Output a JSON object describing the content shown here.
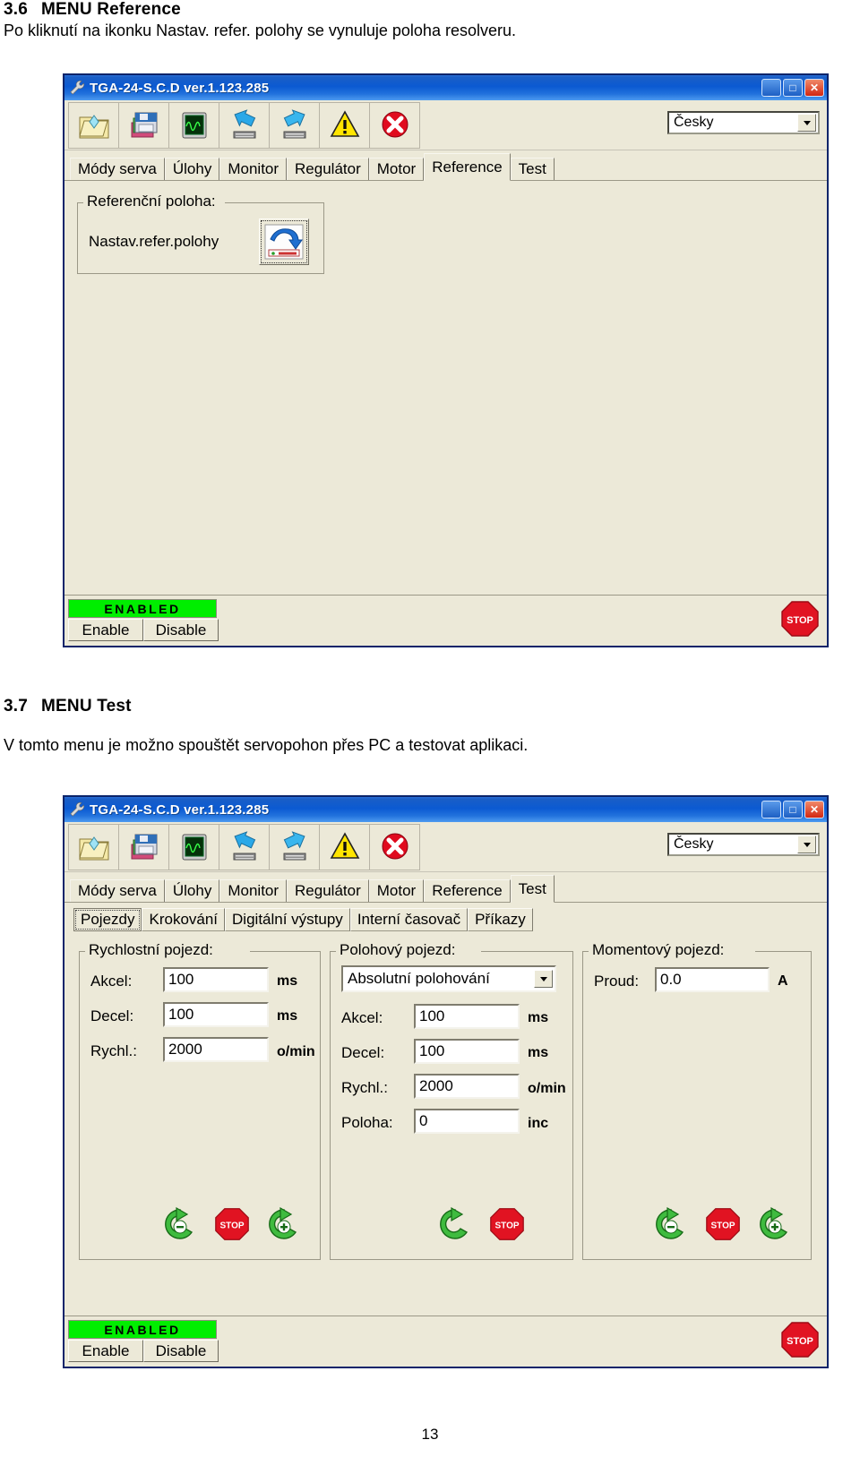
{
  "page": {
    "number": "13"
  },
  "sections": [
    {
      "number": "3.6",
      "heading": "MENU Reference",
      "paragraph": "Po kliknutí na ikonku Nastav. refer. polohy se vynuluje  poloha resolveru."
    },
    {
      "number": "3.7",
      "heading": "MENU Test",
      "paragraph": "V tomto menu je možno spouštět servopohon přes PC a testovat aplikaci."
    }
  ],
  "window": {
    "title": "TGA-24-S.C.D  ver.1.123.285",
    "title_icon": "wrench-icon",
    "buttons": {
      "minimize": "_",
      "maximize": "□",
      "close": "✕"
    },
    "toolbar": {
      "items": [
        {
          "name": "open-folder-icon",
          "title": "Open"
        },
        {
          "name": "save-disk-icon",
          "title": "Save"
        },
        {
          "name": "oscilloscope-icon",
          "title": "Monitor"
        },
        {
          "name": "download-to-drive-icon",
          "title": "Read"
        },
        {
          "name": "upload-to-drive-icon",
          "title": "Write"
        },
        {
          "name": "warning-icon",
          "title": "Warning"
        },
        {
          "name": "error-stop-icon",
          "title": "Error"
        }
      ],
      "language_value": "Česky"
    },
    "tabs": [
      {
        "label": "Módy serva",
        "active_ref": false,
        "active_test": false
      },
      {
        "label": "Úlohy",
        "active_ref": false,
        "active_test": false
      },
      {
        "label": "Monitor",
        "active_ref": false,
        "active_test": false
      },
      {
        "label": "Regulátor",
        "active_ref": false,
        "active_test": false
      },
      {
        "label": "Motor",
        "active_ref": false,
        "active_test": false
      },
      {
        "label": "Reference",
        "active_ref": true,
        "active_test": false
      },
      {
        "label": "Test",
        "active_ref": false,
        "active_test": true
      }
    ],
    "status": {
      "state_text": "ENABLED",
      "enable_label": "Enable",
      "disable_label": "Disable",
      "stop_label": "STOP"
    }
  },
  "reference_panel": {
    "group_title": "Referenční poloha:",
    "action_label": "Nastav.refer.polohy",
    "action_icon": "set-reference-position-icon"
  },
  "test_panel": {
    "subtabs": [
      {
        "label": "Pojezdy",
        "active": true
      },
      {
        "label": "Krokování",
        "active": false
      },
      {
        "label": "Digitální výstupy",
        "active": false
      },
      {
        "label": "Interní časovač",
        "active": false
      },
      {
        "label": "Příkazy",
        "active": false
      }
    ],
    "speed_group": {
      "title": "Rychlostní pojezd:",
      "rows": [
        {
          "label": "Akcel:",
          "value": "100",
          "unit": "ms"
        },
        {
          "label": "Decel:",
          "value": "100",
          "unit": "ms"
        },
        {
          "label": "Rychl.:",
          "value": "2000",
          "unit": "o/min"
        }
      ],
      "controls": [
        {
          "name": "jog-negative-button",
          "icon": "green-arrow-minus-icon"
        },
        {
          "name": "stop-button",
          "icon": "stop-sign-icon",
          "label": "STOP"
        },
        {
          "name": "jog-positive-button",
          "icon": "green-arrow-plus-icon"
        }
      ]
    },
    "position_group": {
      "title": "Polohový pojezd:",
      "mode_value": "Absolutní polohování",
      "rows": [
        {
          "label": "Akcel:",
          "value": "100",
          "unit": "ms"
        },
        {
          "label": "Decel:",
          "value": "100",
          "unit": "ms"
        },
        {
          "label": "Rychl.:",
          "value": "2000",
          "unit": "o/min"
        },
        {
          "label": "Poloha:",
          "value": "0",
          "unit": "inc"
        }
      ],
      "controls": [
        {
          "name": "start-move-button",
          "icon": "green-circular-arrow-icon"
        },
        {
          "name": "stop-button",
          "icon": "stop-sign-icon",
          "label": "STOP"
        }
      ]
    },
    "torque_group": {
      "title": "Momentový pojezd:",
      "rows": [
        {
          "label": "Proud:",
          "value": "0.0",
          "unit": "A"
        }
      ],
      "controls": [
        {
          "name": "torque-negative-button",
          "icon": "green-arrow-minus-icon"
        },
        {
          "name": "stop-button",
          "icon": "stop-sign-icon",
          "label": "STOP"
        },
        {
          "name": "torque-positive-button",
          "icon": "green-arrow-plus-icon"
        }
      ]
    }
  }
}
